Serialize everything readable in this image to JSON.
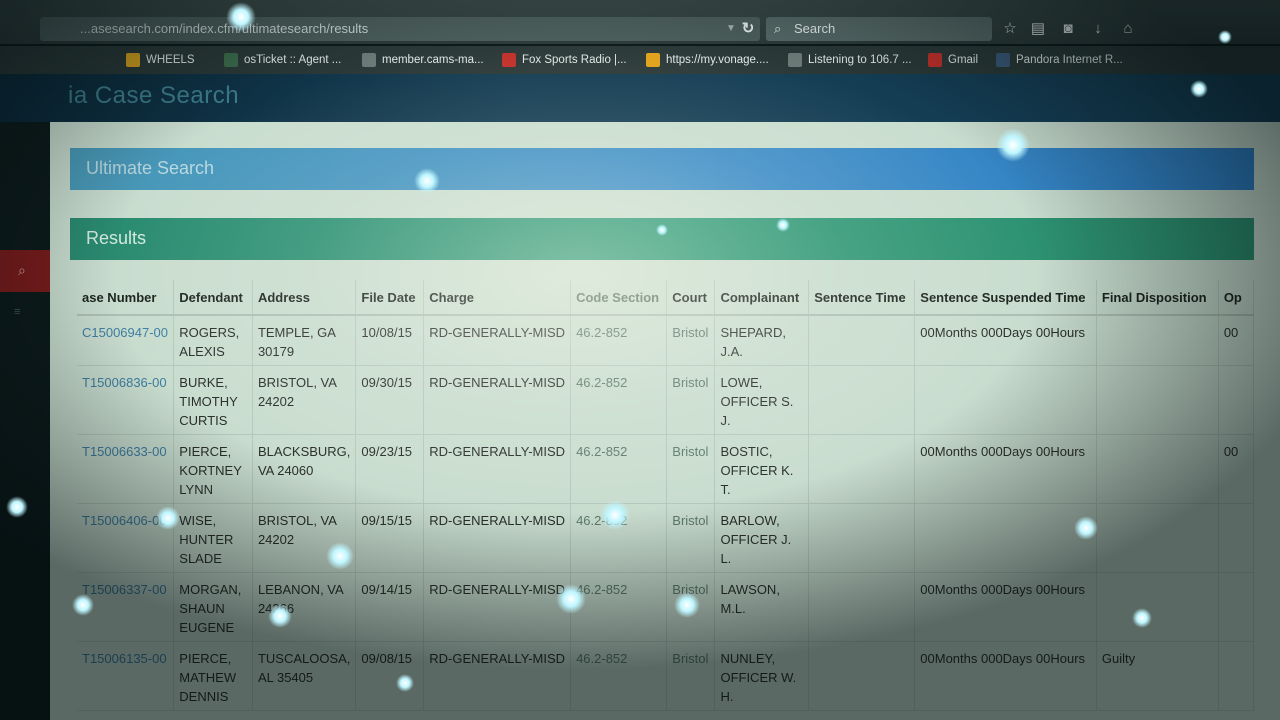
{
  "browser": {
    "url": "...asesearch.com/index.cfm/ultimatesearch/results",
    "search_placeholder": "Search",
    "bookmarks": [
      {
        "label": "WHEELS",
        "color": "#d4a11f"
      },
      {
        "label": "osTicket :: Agent ...",
        "color": "#3b6b4c"
      },
      {
        "label": "member.cams-ma...",
        "color": "#6b7a76"
      },
      {
        "label": "Fox Sports Radio |...",
        "color": "#c0302a"
      },
      {
        "label": "https://my.vonage....",
        "color": "#e0a11a"
      },
      {
        "label": "Listening to 106.7 ...",
        "color": "#6b7a76"
      },
      {
        "label": "Gmail",
        "color": "#c0302a"
      },
      {
        "label": "Pandora Internet R...",
        "color": "#3a5a7a"
      }
    ]
  },
  "site": {
    "title": "ia Case Search"
  },
  "panels": {
    "ultimate": "Ultimate Search",
    "results": "Results"
  },
  "table": {
    "headers": [
      "ase Number",
      "Defendant",
      "Address",
      "File Date",
      "Charge",
      "Code Section",
      "Court",
      "Complainant",
      "Sentence Time",
      "Sentence Suspended Time",
      "Final Disposition",
      "Op"
    ],
    "rows": [
      {
        "case": "C15006947-00",
        "defendant": "ROGERS, ALEXIS",
        "address": "TEMPLE, GA 30179",
        "file_date": "10/08/15",
        "charge": "RD-GENERALLY-MISD",
        "code": "46.2-852",
        "court": "Bristol",
        "complainant": "SHEPARD, J.A.",
        "sentence": "",
        "suspended": "00Months 000Days 00Hours",
        "disposition": "",
        "op": "00"
      },
      {
        "case": "T15006836-00",
        "defendant": "BURKE, TIMOTHY CURTIS",
        "address": "BRISTOL, VA 24202",
        "file_date": "09/30/15",
        "charge": "RD-GENERALLY-MISD",
        "code": "46.2-852",
        "court": "Bristol",
        "complainant": "LOWE, OFFICER S. J.",
        "sentence": "",
        "suspended": "",
        "disposition": "",
        "op": ""
      },
      {
        "case": "T15006633-00",
        "defendant": "PIERCE, KORTNEY LYNN",
        "address": "BLACKSBURG, VA 24060",
        "file_date": "09/23/15",
        "charge": "RD-GENERALLY-MISD",
        "code": "46.2-852",
        "court": "Bristol",
        "complainant": "BOSTIC, OFFICER K. T.",
        "sentence": "",
        "suspended": "00Months 000Days 00Hours",
        "disposition": "",
        "op": "00"
      },
      {
        "case": "T15006406-00",
        "defendant": "WISE, HUNTER SLADE",
        "address": "BRISTOL, VA 24202",
        "file_date": "09/15/15",
        "charge": "RD-GENERALLY-MISD",
        "code": "46.2-852",
        "court": "Bristol",
        "complainant": "BARLOW, OFFICER J. L.",
        "sentence": "",
        "suspended": "",
        "disposition": "",
        "op": ""
      },
      {
        "case": "T15006337-00",
        "defendant": "MORGAN, SHAUN EUGENE",
        "address": "LEBANON, VA 24266",
        "file_date": "09/14/15",
        "charge": "RD-GENERALLY-MISD",
        "code": "46.2-852",
        "court": "Bristol",
        "complainant": "LAWSON, M.L.",
        "sentence": "",
        "suspended": "00Months 000Days 00Hours",
        "disposition": "",
        "op": ""
      },
      {
        "case": "T15006135-00",
        "defendant": "PIERCE, MATHEW DENNIS",
        "address": "TUSCALOOSA, AL 35405",
        "file_date": "09/08/15",
        "charge": "RD-GENERALLY-MISD",
        "code": "46.2-852",
        "court": "Bristol",
        "complainant": "NUNLEY, OFFICER W. H.",
        "sentence": "",
        "suspended": "00Months 000Days 00Hours",
        "disposition": "Guilty",
        "op": ""
      }
    ]
  }
}
